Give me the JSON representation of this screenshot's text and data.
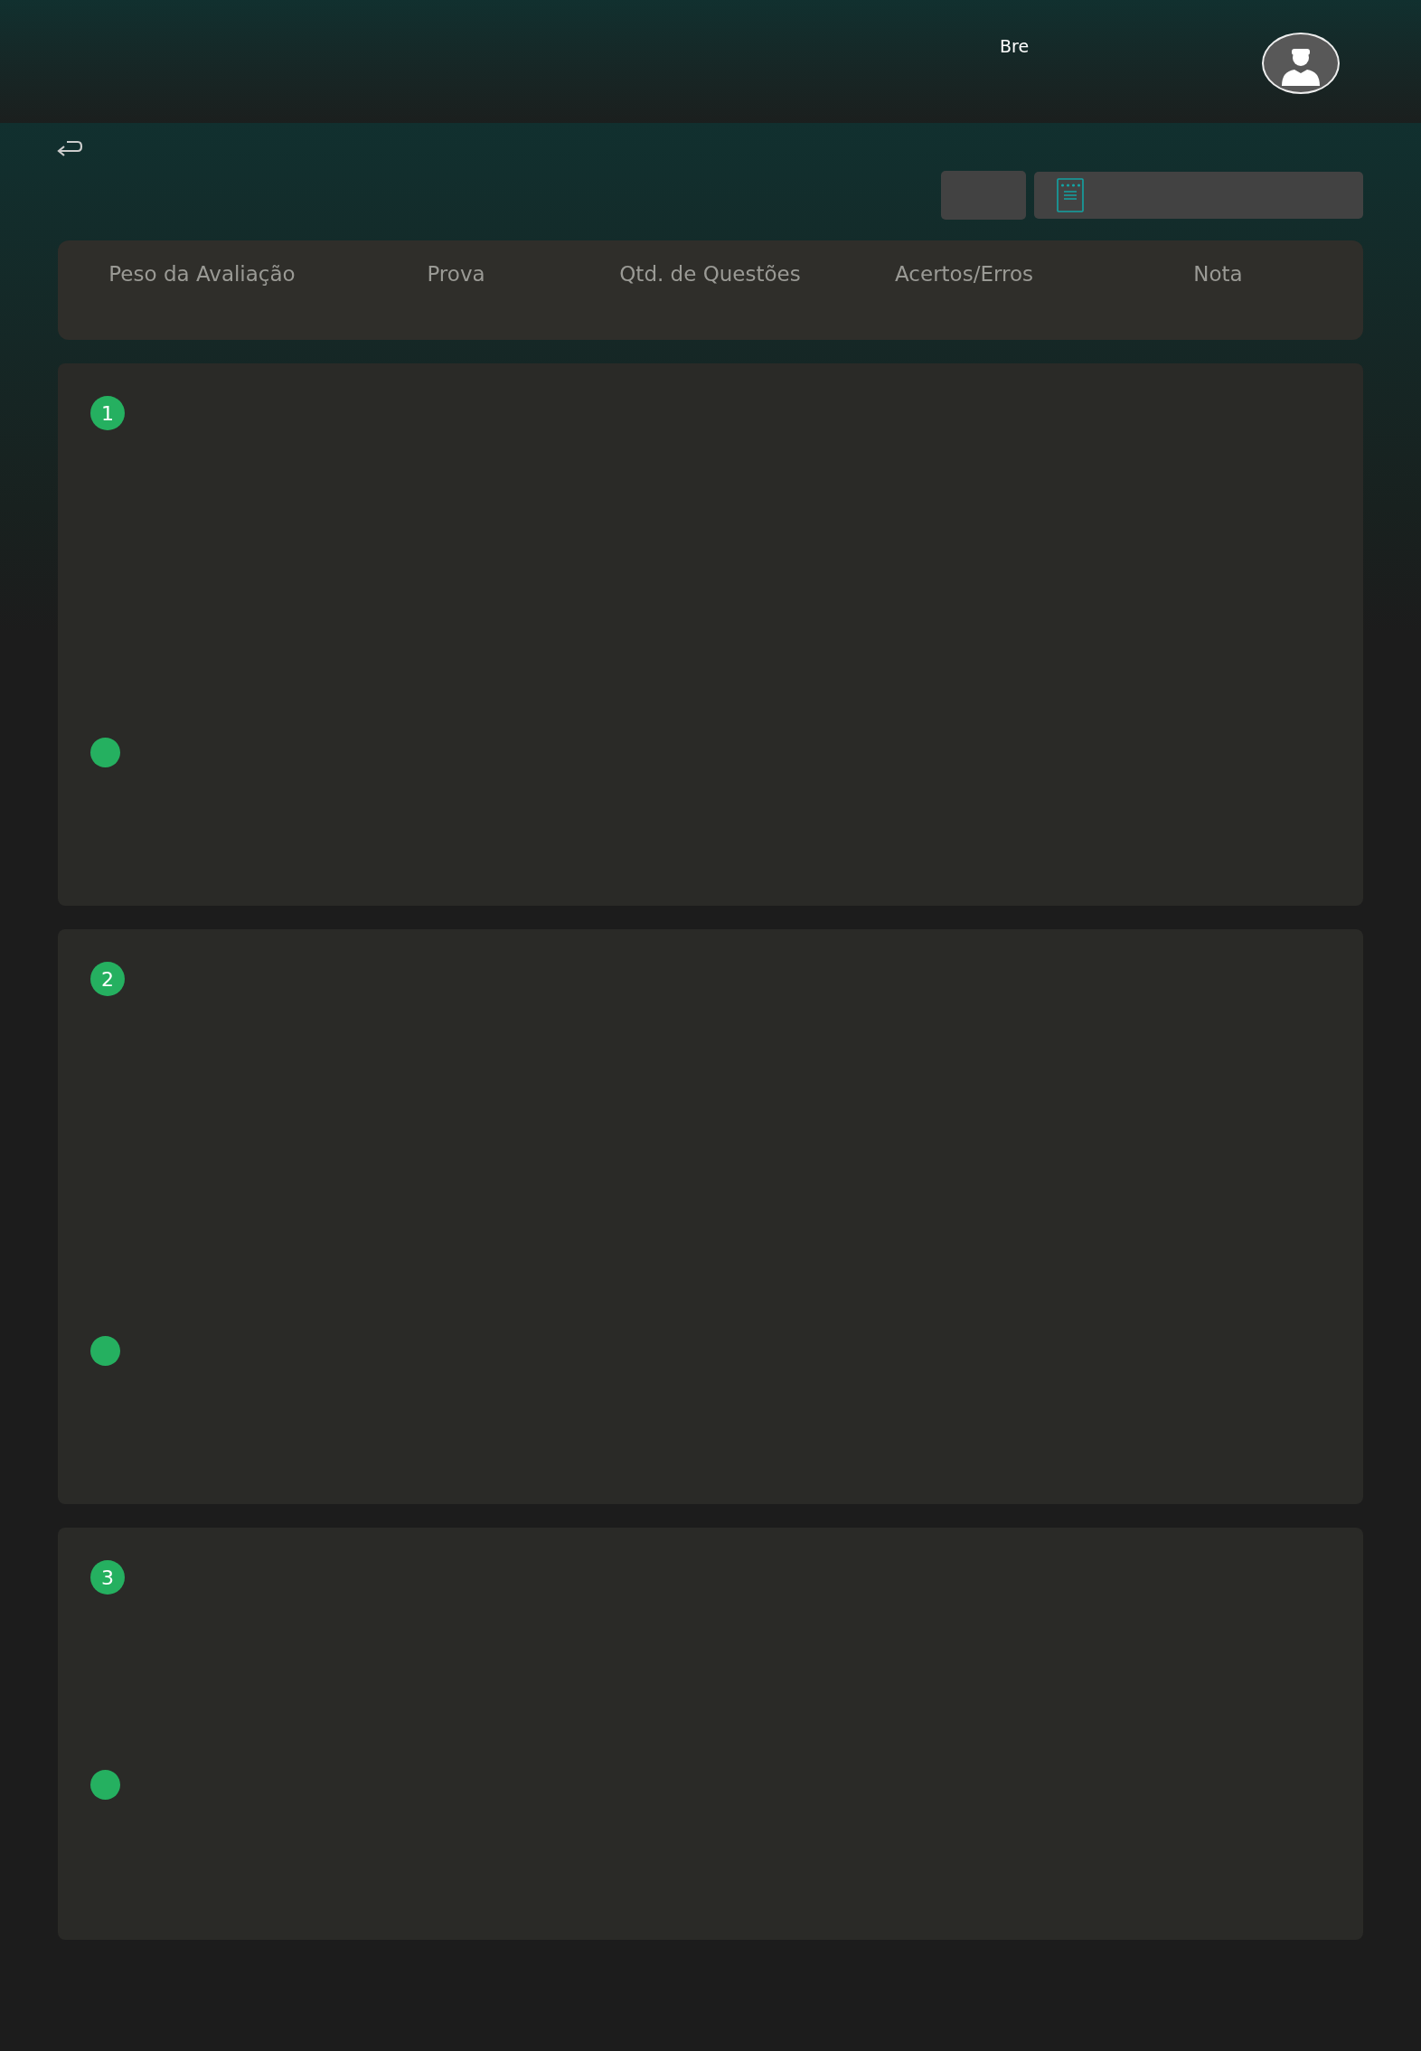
{
  "header": {
    "user_name": "Bre"
  },
  "table_header": {
    "columns": [
      "Peso da Avaliação",
      "Prova",
      "Qtd. de Questões",
      "Acertos/Erros",
      "Nota"
    ]
  },
  "sections": [
    {
      "number": "1"
    },
    {
      "number": "2"
    },
    {
      "number": "3"
    }
  ]
}
